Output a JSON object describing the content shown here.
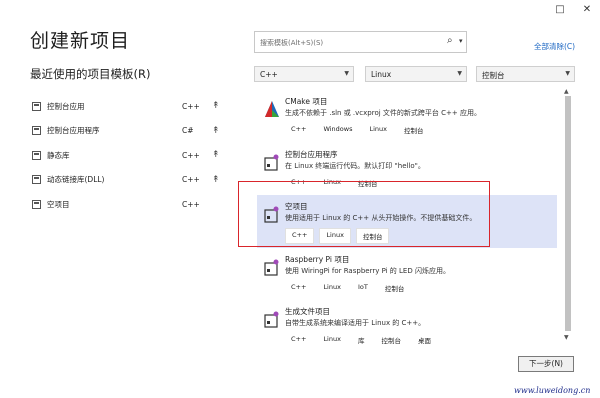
{
  "window": {
    "maximize_icon": "□",
    "close_icon": "✕"
  },
  "page_title": "创建新项目",
  "recent": {
    "title": "最近使用的项目模板(R)",
    "items": [
      {
        "label": "控制台应用",
        "lang": "C++",
        "pin": "↟"
      },
      {
        "label": "控制台应用程序",
        "lang": "C#",
        "pin": "↟"
      },
      {
        "label": "静态库",
        "lang": "C++",
        "pin": "↟"
      },
      {
        "label": "动态链接库(DLL)",
        "lang": "C++",
        "pin": "↟"
      },
      {
        "label": "空项目",
        "lang": "C++",
        "pin": "↟"
      }
    ]
  },
  "search": {
    "placeholder": "搜索模板(Alt+S)(S)",
    "icon": "⌕",
    "drop": "▾"
  },
  "clear_all": "全部清除(C)",
  "filters": {
    "language": "C++",
    "platform": "Linux",
    "project_type": "控制台",
    "arrow": "▼"
  },
  "templates": [
    {
      "name": "CMake 项目",
      "desc": "生成不依赖于 .sln 或 .vcxproj 文件的新式跨平台 C++ 应用。",
      "tags": [
        "C++",
        "Windows",
        "Linux",
        "控制台"
      ],
      "icon": "cmake-icon"
    },
    {
      "name": "控制台应用程序",
      "desc": "在 Linux 终端运行代码。默认打印 \"hello\"。",
      "tags": [
        "C++",
        "Linux",
        "控制台"
      ],
      "icon": "linux-project-icon"
    },
    {
      "name": "空项目",
      "desc": "使用适用于 Linux 的 C++ 从头开始操作。不提供基础文件。",
      "tags": [
        "C++",
        "Linux",
        "控制台"
      ],
      "icon": "linux-project-icon"
    },
    {
      "name": "Raspberry Pi 项目",
      "desc": "使用 WiringPi for Raspberry Pi 的 LED 闪烁应用。",
      "tags": [
        "C++",
        "Linux",
        "IoT",
        "控制台"
      ],
      "icon": "linux-project-icon"
    },
    {
      "name": "生成文件项目",
      "desc": "自带生成系统来编译适用于 Linux 的 C++。",
      "tags": [
        "C++",
        "Linux",
        "库",
        "控制台",
        "桌面"
      ],
      "icon": "linux-project-icon"
    }
  ],
  "scroll": {
    "up": "▲",
    "down": "▼"
  },
  "next_button": "下一步(N)",
  "watermark": "www.luweidong.cn",
  "colors": {
    "accent_link": "#1a65c2",
    "selected_bg": "#dde3f7",
    "highlight_border": "#d9252b"
  }
}
